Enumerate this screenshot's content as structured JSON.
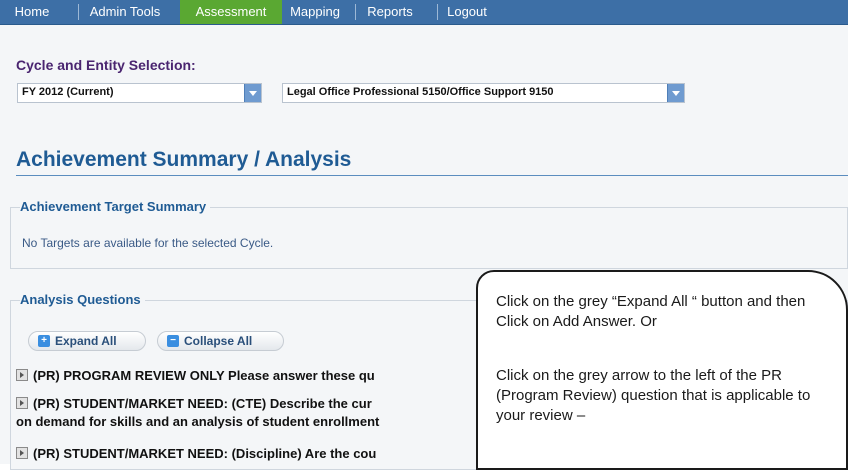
{
  "nav": [
    "Home",
    "Admin Tools",
    "Assessment",
    "Mapping",
    "Reports",
    "Logout"
  ],
  "cycle": {
    "label": "Cycle and Entity Selection:",
    "cycle_value": "FY 2012  (Current)",
    "entity_value": "Legal Office Professional 5150/Office Support 9150"
  },
  "page_title": "Achievement Summary / Analysis",
  "targets": {
    "legend": "Achievement Target Summary",
    "empty_text": "No Targets are available for the selected Cycle."
  },
  "analysis": {
    "legend": "Analysis Questions",
    "expand_label": "Expand All",
    "collapse_label": "Collapse All",
    "questions": [
      "(PR) PROGRAM REVIEW ONLY Please answer these qu",
      "(PR) STUDENT/MARKET NEED: (CTE) Describe the cur",
      "on demand for skills and an analysis of student enrollment",
      "(PR) STUDENT/MARKET NEED: (Discipline) Are the cou"
    ]
  },
  "callout": {
    "para1": "Click on the grey “Expand All “ button and then Click  on Add Answer.   Or",
    "para2": "Click on the grey arrow to the left of the PR (Program Review) question that is applicable to your review –"
  },
  "colors": {
    "nav_bg": "#3d6fa6",
    "nav_active": "#5aa832",
    "title": "#1f5b94"
  }
}
